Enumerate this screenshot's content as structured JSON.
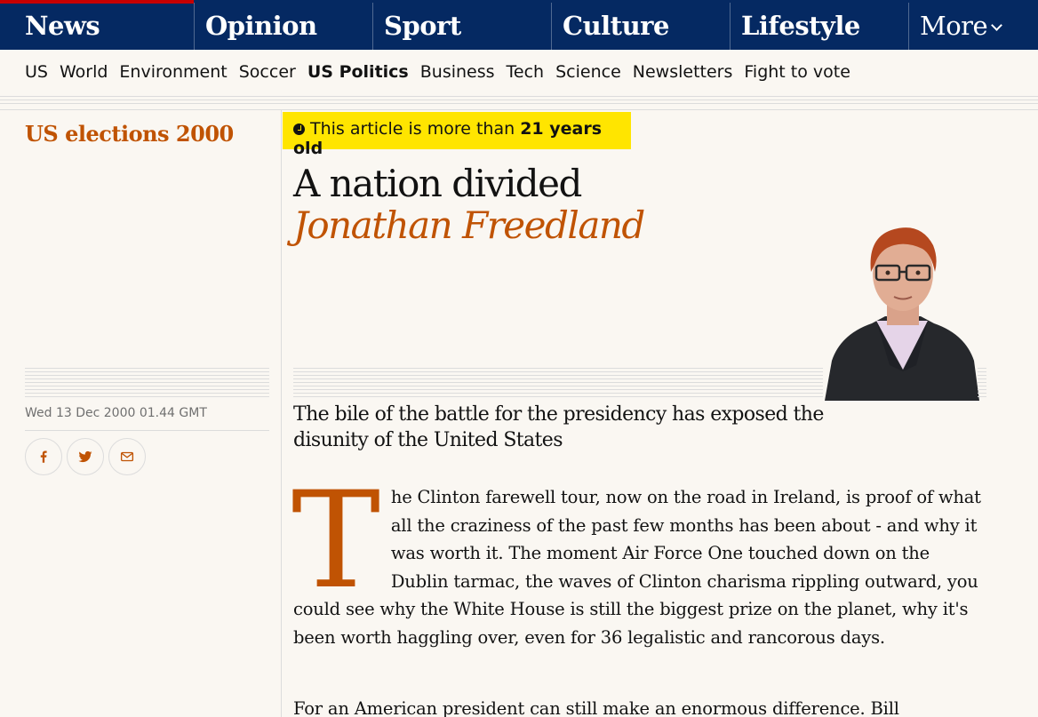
{
  "nav": {
    "pillars": [
      "News",
      "Opinion",
      "Sport",
      "Culture",
      "Lifestyle"
    ],
    "more_label": "More"
  },
  "subnav": [
    "US",
    "World",
    "Environment",
    "Soccer",
    "US Politics",
    "Business",
    "Tech",
    "Science",
    "Newsletters",
    "Fight to vote"
  ],
  "sidebar": {
    "series": "US elections 2000",
    "dateline": "Wed 13 Dec 2000 01.44 GMT",
    "share_icons": [
      "facebook-icon",
      "twitter-icon",
      "email-icon"
    ]
  },
  "age_warning": {
    "prefix": "This article is more than ",
    "age": "21 years old"
  },
  "article": {
    "headline": "A nation divided",
    "byline": "Jonathan Freedland",
    "standfirst": "The bile of the battle for the presidency has exposed the disunity of the United States",
    "dropcap": "T",
    "para1": "he Clinton farewell tour, now on the road in Ireland, is proof of what all the craziness of the past few months has been about - and why it was worth it. The moment Air Force One touched down on the Dublin tarmac, the waves of Clinton charisma rippling outward, you could see why the White House is still the biggest prize on the planet, why it's been worth haggling over, even for 36 legalistic and rancorous days.",
    "para2": "For an American president can still make an enormous difference. Bill"
  },
  "colors": {
    "nav_bg": "#052962",
    "accent": "#c05303",
    "age_bg": "#ffe500",
    "news_active": "#c70000"
  }
}
